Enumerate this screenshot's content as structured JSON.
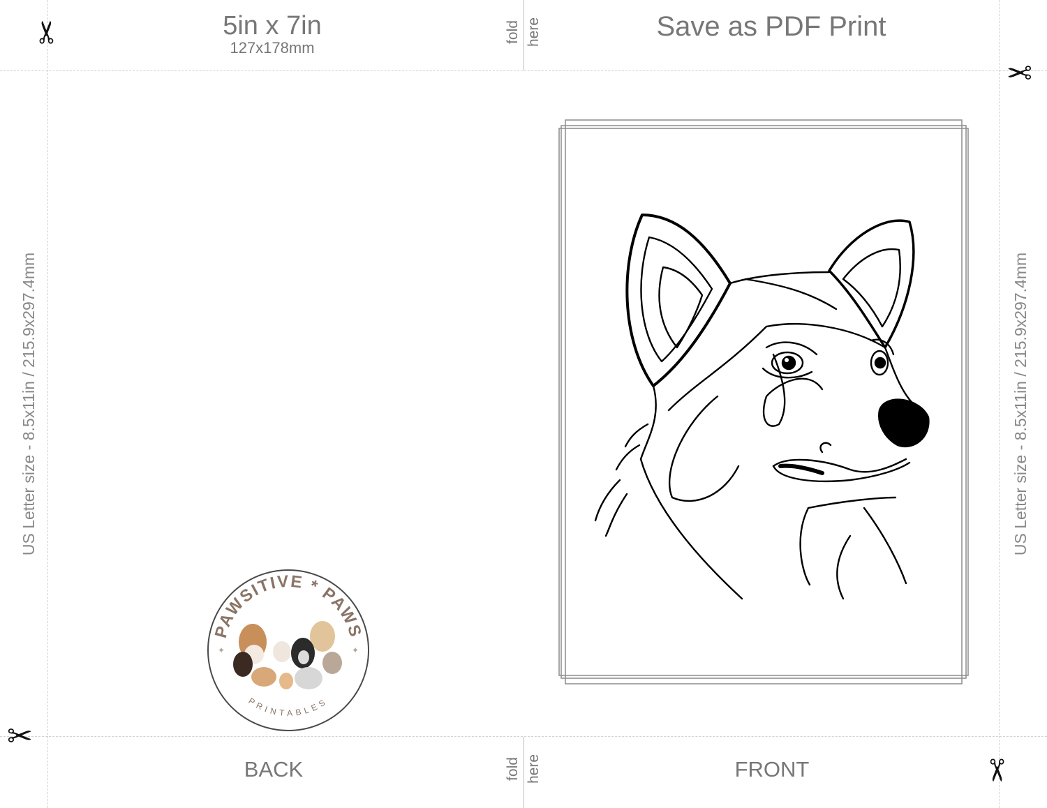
{
  "header": {
    "size_title": "5in x 7in",
    "size_sub": "127x178mm",
    "fold_word": "fold",
    "here_word": "here",
    "save_title": "Save as PDF Print"
  },
  "footer": {
    "back_label": "BACK",
    "front_label": "FRONT",
    "fold_word": "fold",
    "here_word": "here"
  },
  "side": {
    "left_text": "US Letter size - 8.5x11in / 215.9x297.4mm",
    "right_text": "US Letter size - 8.5x11in / 215.9x297.4mm"
  },
  "logo": {
    "arc_text": "PAWSITIVE * PAWS",
    "bottom_text": "PRINTABLES"
  },
  "icons": {
    "scissors": "scissors-icon",
    "scissors_glyph": "✂"
  },
  "colors": {
    "text_gray": "#777777",
    "logo_brown": "#8a7466",
    "guide": "#d2d2d2"
  }
}
